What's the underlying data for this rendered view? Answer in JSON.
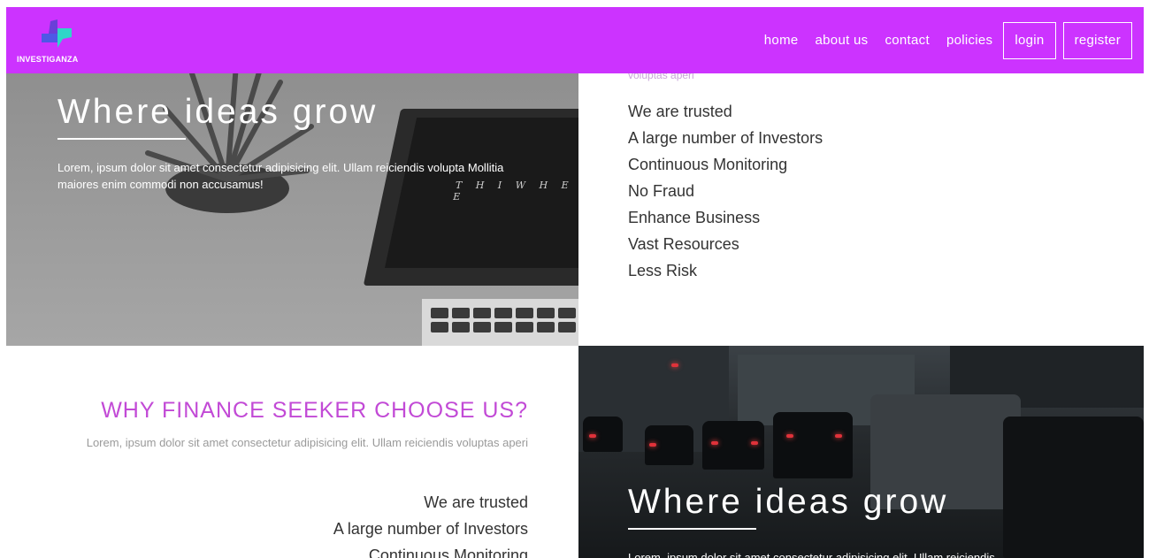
{
  "brand": {
    "name": "INVESTIGANZA",
    "accent": "#cc33ff"
  },
  "nav": {
    "links": [
      "home",
      "about us",
      "contact",
      "policies"
    ],
    "login_label": "login",
    "register_label": "register"
  },
  "hero_left": {
    "title": "Where ideas grow",
    "text": "Lorem, ipsum dolor sit amet consectetur adipisicing elit. Ullam reiciendis volupta Mollitia maiores enim commodi non accusamus!",
    "laptop_text": "T H I   W H E R E"
  },
  "hero_right": {
    "title": "Where ideas grow",
    "text": "Lorem, ipsum dolor sit amet consectetur adipisicing elit. Ullam reiciendis"
  },
  "investors_section": {
    "cut_text": "voluptas aperi",
    "features": [
      "We are trusted",
      "A large number of Investors",
      "Continuous Monitoring",
      "No Fraud",
      "Enhance Business",
      "Vast Resources",
      "Less Risk"
    ]
  },
  "finance_section": {
    "title": "WHY FINANCE SEEKER CHOOSE US?",
    "description": "Lorem, ipsum dolor sit amet consectetur adipisicing elit. Ullam reiciendis voluptas aperi",
    "features": [
      "We are trusted",
      "A large number of Investors",
      "Continuous Monitoring"
    ]
  }
}
